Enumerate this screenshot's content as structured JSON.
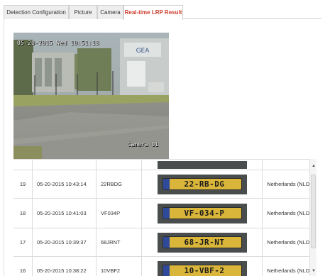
{
  "tabs": [
    {
      "label": "Detection Configuration",
      "active": false
    },
    {
      "label": "Picture",
      "active": false
    },
    {
      "label": "Camera",
      "active": false
    },
    {
      "label": "Real-time LRP Result",
      "active": true
    }
  ],
  "camera": {
    "timestamp": "05-20-2015 Wed 10:51:18",
    "label": "Camera 01",
    "sign_text": "GEA"
  },
  "results": {
    "rows": [
      {
        "no": "",
        "time": "",
        "plate": "",
        "plate_image": "",
        "country": ""
      },
      {
        "no": "19",
        "time": "05-20-2015 10:43:14",
        "plate": "22RBDG",
        "plate_image": "22-RB-DG",
        "country": "Netherlands (NLD)"
      },
      {
        "no": "18",
        "time": "05-20-2015 10:41:03",
        "plate": "VF034P",
        "plate_image": "VF-034-P",
        "country": "Netherlands (NLD)"
      },
      {
        "no": "17",
        "time": "05-20-2015 10:39:37",
        "plate": "68JRNT",
        "plate_image": "68-JR-NT",
        "country": "Netherlands (NLD)"
      },
      {
        "no": "16",
        "time": "05-20-2015 10:38:22",
        "plate": "10VBF2",
        "plate_image": "10-VBF-2",
        "country": "Netherlands (NLD)"
      }
    ]
  },
  "colors": {
    "active_tab_text": "#cc3b2b",
    "plate_yellow": "#d9b53a",
    "eu_band": "#2f4a9a"
  },
  "icons": {
    "scroll_up": "▲",
    "scroll_down": "▼"
  }
}
